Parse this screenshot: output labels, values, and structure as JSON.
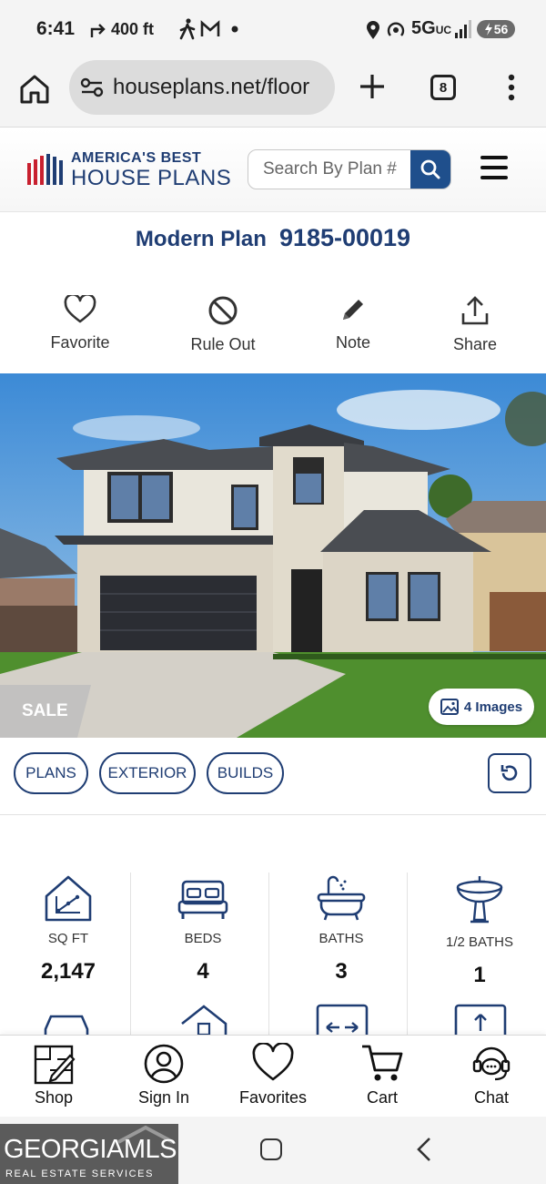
{
  "status_bar": {
    "time": "6:41",
    "nav_distance": "400 ft",
    "network": "5G",
    "network_sub": "UC",
    "battery": "56"
  },
  "browser": {
    "url": "houseplans.net/floor",
    "tab_count": "8"
  },
  "site": {
    "logo_line1": "AMERICA'S BEST",
    "logo_line2": "HOUSE PLANS",
    "search_placeholder": "Search By Plan #"
  },
  "plan": {
    "style": "Modern Plan",
    "number": "9185-00019"
  },
  "actions": [
    {
      "label": "Favorite",
      "icon": "heart-icon"
    },
    {
      "label": "Rule Out",
      "icon": "ban-icon"
    },
    {
      "label": "Note",
      "icon": "pencil-icon"
    },
    {
      "label": "Share",
      "icon": "share-icon"
    }
  ],
  "hero": {
    "sale_label": "SALE",
    "images_label": "4 Images"
  },
  "chips": [
    "PLANS",
    "EXTERIOR",
    "BUILDS"
  ],
  "stats": [
    {
      "label": "SQ FT",
      "value": "2,147",
      "icon": "house-sqft-icon"
    },
    {
      "label": "BEDS",
      "value": "4",
      "icon": "bed-icon"
    },
    {
      "label": "BATHS",
      "value": "3",
      "icon": "bathtub-icon"
    },
    {
      "label": "1/2 BATHS",
      "value": "1",
      "icon": "sink-icon"
    }
  ],
  "bottom_nav": [
    {
      "label": "Shop",
      "icon": "shop-icon"
    },
    {
      "label": "Sign In",
      "icon": "user-icon"
    },
    {
      "label": "Favorites",
      "icon": "heart-icon"
    },
    {
      "label": "Cart",
      "icon": "cart-icon"
    },
    {
      "label": "Chat",
      "icon": "chat-headset-icon"
    }
  ],
  "watermark": {
    "line1": "GEORGIAMLS",
    "line2": "REAL ESTATE SERVICES"
  },
  "colors": {
    "brand_navy": "#1f3d73",
    "brand_red": "#c8202f",
    "search_button": "#1f4f8c"
  }
}
